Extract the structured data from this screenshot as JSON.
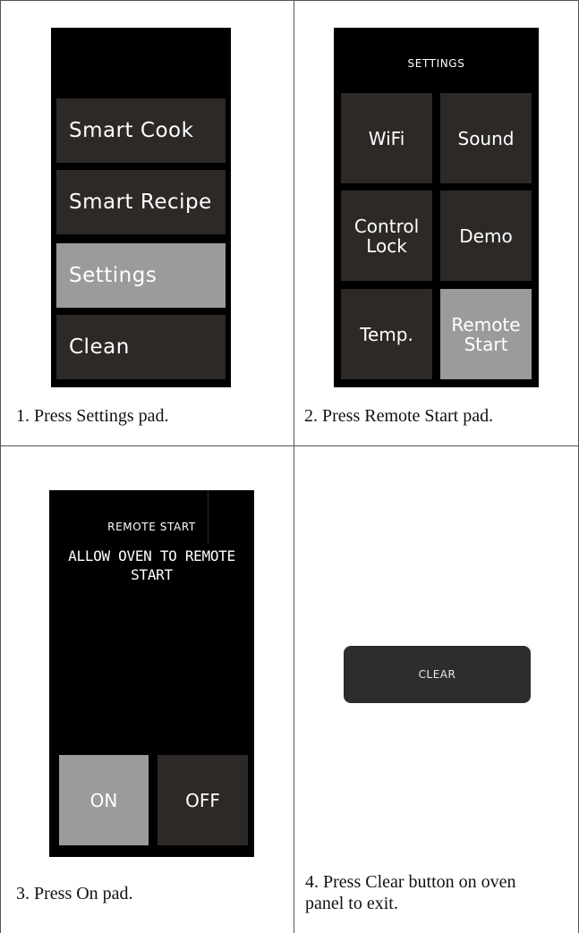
{
  "steps": [
    {
      "caption": "1. Press Settings pad.",
      "menu": [
        "Smart Cook",
        "Smart Recipe",
        "Settings",
        "Clean"
      ],
      "active_item": "Settings"
    },
    {
      "caption": "2. Press Remote Start pad.",
      "title": "SETTINGS",
      "pads": [
        "WiFi",
        "Sound",
        "Control Lock",
        "Demo",
        "Temp.",
        "Remote Start"
      ],
      "active_item": "Remote Start"
    },
    {
      "caption": "3. Press On pad.",
      "title": "REMOTE START",
      "message": "ALLOW OVEN TO REMOTE START",
      "on_label": "ON",
      "off_label": "OFF",
      "active_item": "ON"
    },
    {
      "caption": "4. Press Clear button on oven panel to exit.",
      "button_label": "CLEAR"
    }
  ],
  "colors": {
    "screen_background": "#000000",
    "pad": "#2c2927",
    "pad_selected": "#9b9b9b",
    "pad_text": "#ffffff",
    "grid_line": "#555555"
  }
}
